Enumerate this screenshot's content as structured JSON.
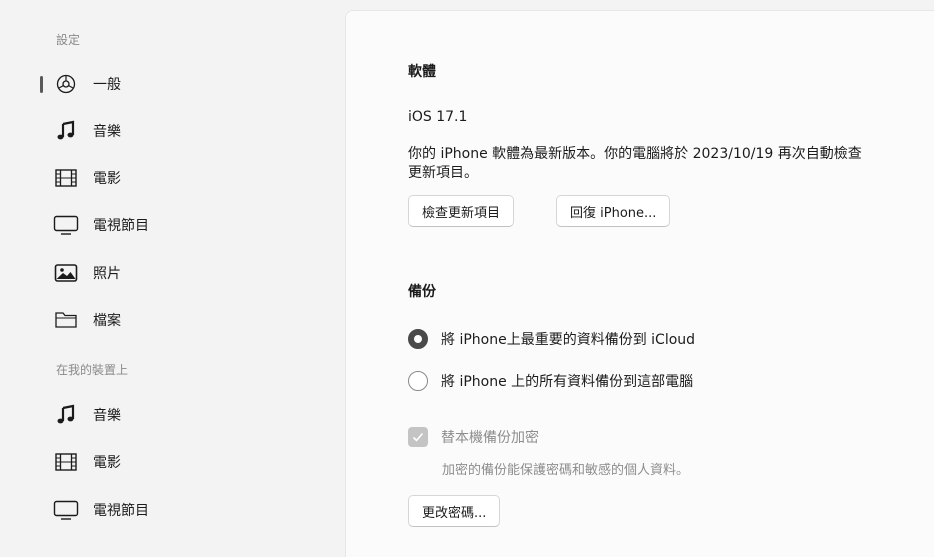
{
  "sidebar": {
    "settings_title": "設定",
    "settings_items": [
      {
        "label": "一般",
        "icon": "gear-icon",
        "selected": true
      },
      {
        "label": "音樂",
        "icon": "music-note-icon"
      },
      {
        "label": "電影",
        "icon": "film-icon"
      },
      {
        "label": "電視節目",
        "icon": "tv-icon"
      },
      {
        "label": "照片",
        "icon": "photo-icon"
      },
      {
        "label": "檔案",
        "icon": "folder-icon"
      }
    ],
    "device_title": "在我的裝置上",
    "device_items": [
      {
        "label": "音樂",
        "icon": "music-note-icon"
      },
      {
        "label": "電影",
        "icon": "film-icon"
      },
      {
        "label": "電視節目",
        "icon": "tv-icon"
      }
    ]
  },
  "software": {
    "heading": "軟體",
    "version": "iOS 17.1",
    "status_line1": "你的 iPhone 軟體為最新版本。你的電腦將於 2023/10/19 再次自動檢查",
    "status_line2": "更新項目。",
    "check_button": "檢查更新項目",
    "restore_button": "回復 iPhone..."
  },
  "backup": {
    "heading": "備份",
    "option_icloud": "將 iPhone上最重要的資料備份到 iCloud",
    "option_computer": "將 iPhone 上的所有資料備份到這部電腦",
    "selected": "icloud",
    "encrypt_label": "替本機備份加密",
    "encrypt_checked": true,
    "encrypt_note": "加密的備份能保護密碼和敏感的個人資料。",
    "change_password_button": "更改密碼..."
  }
}
